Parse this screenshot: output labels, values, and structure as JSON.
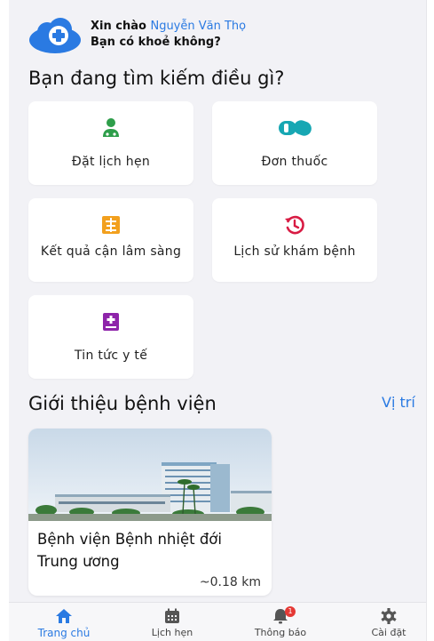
{
  "header": {
    "greeting": "Xin chào",
    "user_name": "Nguyễn Văn Thọ",
    "subtitle": "Bạn có khoẻ không?"
  },
  "search_section": {
    "title": "Bạn đang tìm kiếm điều gì?",
    "items": [
      {
        "label": "Đặt lịch hẹn",
        "icon": "doctor-icon",
        "color": "#2e9e4a"
      },
      {
        "label": "Đơn thuốc",
        "icon": "pill-icon",
        "color": "#17a7b3"
      },
      {
        "label": "Kết quả cận lâm sàng",
        "icon": "lab-result-icon",
        "color": "#f2a01e"
      },
      {
        "label": "Lịch sử khám bệnh",
        "icon": "history-icon",
        "color": "#d81b43"
      },
      {
        "label": "Tin tức y tế",
        "icon": "medical-news-icon",
        "color": "#8e24aa"
      }
    ]
  },
  "hospital_section": {
    "title": "Giới thiệu bệnh viện",
    "location_link": "Vị trí",
    "hospital": {
      "name": "Bệnh viện Bệnh nhiệt đới Trung ương",
      "distance": "~0.18 km"
    }
  },
  "nav": {
    "items": [
      {
        "label": "Trang chủ",
        "icon": "home-icon",
        "active": true
      },
      {
        "label": "Lịch hẹn",
        "icon": "calendar-icon",
        "active": false
      },
      {
        "label": "Thông báo",
        "icon": "bell-icon",
        "active": false,
        "badge": "1"
      },
      {
        "label": "Cài đặt",
        "icon": "gear-icon",
        "active": false
      }
    ]
  },
  "colors": {
    "accent": "#2a7ae2",
    "background": "#f2f2f6",
    "badge": "#e53935"
  }
}
